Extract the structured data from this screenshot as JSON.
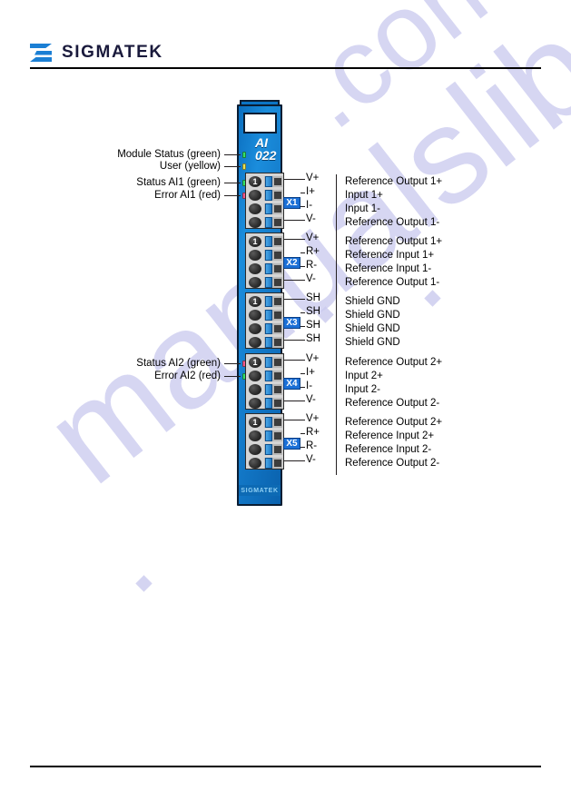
{
  "header": {
    "brand": "SIGMATEK",
    "logo_icon": "sigmatek-logo-icon"
  },
  "watermark": {
    "line1": "manualslib",
    "line2": ".com"
  },
  "module": {
    "name_line1": "AI",
    "name_line2": "022",
    "brand_plate": "SIGMATEK",
    "screw_number": "1"
  },
  "status_leds": [
    {
      "label": "Module Status (green)",
      "color": "#34e06a",
      "kind": "green"
    },
    {
      "label": "User (yellow)",
      "color": "#e8e257",
      "kind": "yellow"
    },
    {
      "label": "Status AI1 (green)",
      "color": "#34e06a",
      "kind": "green"
    },
    {
      "label": "Error AI1 (red)",
      "color": "#f05a8c",
      "kind": "red"
    },
    {
      "label": "Status AI2 (green)",
      "color": "#34e06a",
      "kind": "green"
    },
    {
      "label": "Error AI2 (red)",
      "color": "#f05a8c",
      "kind": "red"
    }
  ],
  "connectors": [
    {
      "badge": "X1",
      "pins": [
        {
          "name": "V+",
          "description": "Reference Output 1+"
        },
        {
          "name": "I+",
          "description": "Input 1+"
        },
        {
          "name": "I-",
          "description": "Input 1-"
        },
        {
          "name": "V-",
          "description": "Reference Output 1-"
        }
      ]
    },
    {
      "badge": "X2",
      "pins": [
        {
          "name": "V+",
          "description": "Reference Output 1+"
        },
        {
          "name": "R+",
          "description": "Reference Input 1+"
        },
        {
          "name": "R-",
          "description": "Reference Input 1-"
        },
        {
          "name": "V-",
          "description": "Reference Output 1-"
        }
      ]
    },
    {
      "badge": "X3",
      "pins": [
        {
          "name": "SH",
          "description": "Shield GND"
        },
        {
          "name": "SH",
          "description": "Shield GND"
        },
        {
          "name": "SH",
          "description": "Shield GND"
        },
        {
          "name": "SH",
          "description": "Shield GND"
        }
      ]
    },
    {
      "badge": "X4",
      "pins": [
        {
          "name": "V+",
          "description": "Reference Output 2+"
        },
        {
          "name": "I+",
          "description": "Input 2+"
        },
        {
          "name": "I-",
          "description": "Input 2-"
        },
        {
          "name": "V-",
          "description": "Reference Output 2-"
        }
      ]
    },
    {
      "badge": "X5",
      "pins": [
        {
          "name": "V+",
          "description": "Reference Output 2+"
        },
        {
          "name": "R+",
          "description": "Reference Input 2+"
        },
        {
          "name": "R-",
          "description": "Reference Input 2-"
        },
        {
          "name": "V-",
          "description": "Reference Output 2-"
        }
      ]
    }
  ]
}
